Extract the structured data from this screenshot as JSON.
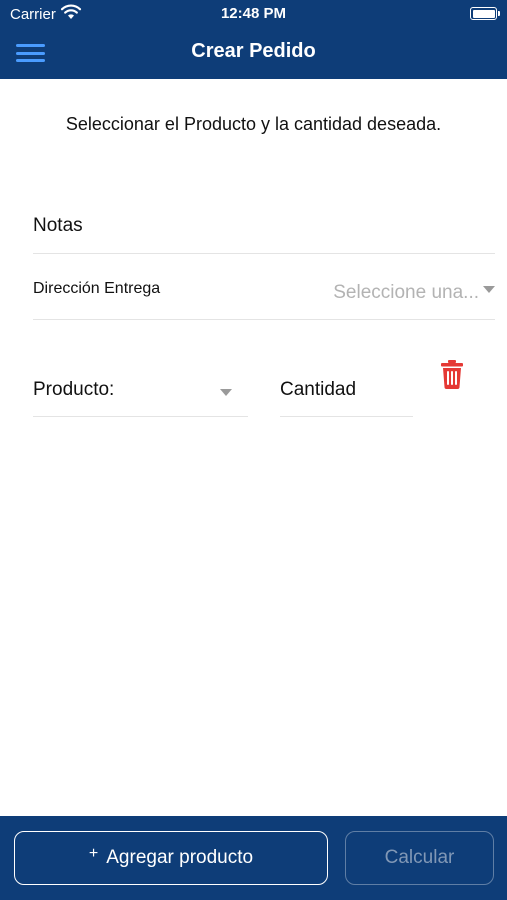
{
  "status_bar": {
    "carrier": "Carrier",
    "time": "12:48 PM",
    "battery_level": 1.0
  },
  "nav": {
    "title": "Crear Pedido",
    "menu_icon": "hamburger-menu-icon"
  },
  "form": {
    "instructions": "Seleccionar el Producto y la cantidad deseada.",
    "notes_placeholder": "Notas",
    "address_label": "Dirección Entrega",
    "address_placeholder": "Seleccione una...",
    "product_label": "Producto:",
    "quantity_placeholder": "Cantidad",
    "delete_icon": "trash-icon"
  },
  "actions": {
    "add_product_label": "Agregar producto",
    "add_icon": "+",
    "calculate_label": "Calcular"
  },
  "colors": {
    "bar_background": "#0e3d78",
    "menu_accent": "#4a9cff",
    "delete_red": "#e53935",
    "disabled_button_text": "#8198b6"
  }
}
